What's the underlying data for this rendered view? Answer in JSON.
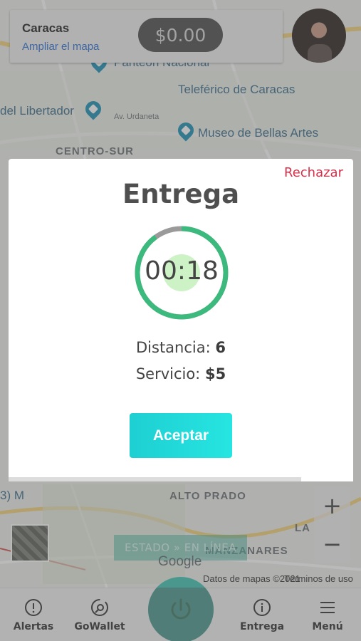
{
  "map": {
    "labels": {
      "panteon": "Panteón Nacional",
      "teleferico": "Teleférico de Caracas",
      "libertador": "del Libertador",
      "urdaneta": "Av. Urdaneta",
      "museo": "Museo de Bellas Artes",
      "centro_sur": "CENTRO-SUR",
      "alto_prado": "ALTO PRADO",
      "manzanares": "MANZANARES",
      "la": "LA",
      "metro": "3) M"
    },
    "google": "Google",
    "credits": "Datos de mapas ©2021",
    "terms": "Términos de uso",
    "zoom_in": "+",
    "zoom_out": "−"
  },
  "header": {
    "city": "Caracas",
    "expand_map": "Ampliar el mapa",
    "balance": "$0.00"
  },
  "modal": {
    "reject": "Rechazar",
    "title": "Entrega",
    "timer": "00:18",
    "timer_remaining_fraction": 0.9,
    "distance_label": "Distancia:",
    "distance_value": "6",
    "service_label": "Servicio:",
    "service_value": "$5",
    "accept": "Aceptar",
    "progress_fraction": 0.85
  },
  "status": {
    "label": "ESTADO » EN LÍNEA"
  },
  "bottom_nav": {
    "items": [
      {
        "label": "Alertas",
        "icon": "alert-circle-icon"
      },
      {
        "label": "GoWallet",
        "icon": "wallet-icon"
      },
      {
        "label": "",
        "icon": "power-icon"
      },
      {
        "label": "Entrega",
        "icon": "info-circle-icon"
      },
      {
        "label": "Menú",
        "icon": "menu-icon"
      }
    ]
  },
  "colors": {
    "accent": "#26e5e1",
    "timer_ring": "#3cb97c",
    "reject": "#d7314a",
    "power": "#3fc3b4"
  }
}
